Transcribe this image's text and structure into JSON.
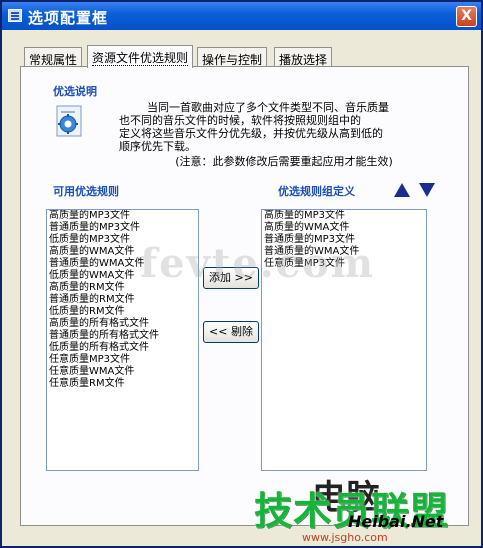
{
  "window": {
    "title": "选项配置框",
    "close_label": "X"
  },
  "tabs": [
    {
      "label": "常规属性"
    },
    {
      "label": "资源文件优选规则"
    },
    {
      "label": "操作与控制"
    },
    {
      "label": "播放选择"
    }
  ],
  "info": {
    "heading": "优选说明",
    "lines": [
      "当同一首歌曲对应了多个文件类型不同、音乐质量",
      "也不同的音乐文件的时候，软件将按照规则组中的",
      "定义将这些音乐文件分优先级，并按优先级从高到低的",
      "顺序优先下载。"
    ],
    "note": "(注意：此参数修改后需要重起应用才能生效)"
  },
  "available": {
    "label": "可用优选规则",
    "items": [
      "高质量的MP3文件",
      "普通质量的MP3文件",
      "低质量的MP3文件",
      "高质量的WMA文件",
      "普通质量的WMA文件",
      "低质量的WMA文件",
      "高质量的RM文件",
      "普通质量的RM文件",
      "低质量的RM文件",
      "高质量的所有格式文件",
      "普通质量的所有格式文件",
      "低质量的所有格式文件",
      "任意质量MP3文件",
      "任意质量WMA文件",
      "任意质量RM文件"
    ]
  },
  "group": {
    "label": "优选规则组定义",
    "items": [
      "高质量的MP3文件",
      "高质量的WMA文件",
      "普通质量的MP3文件",
      "普通质量的WMA文件",
      "任意质量MP3文件"
    ]
  },
  "buttons": {
    "add": "添加 >>",
    "remove": "<< 剔除"
  },
  "watermarks": {
    "center": "fevte.com",
    "logo_cn": "电脑",
    "green": "技术员联盟",
    "heibai": "Heibai.Net",
    "url": "www.jsgho.com"
  }
}
